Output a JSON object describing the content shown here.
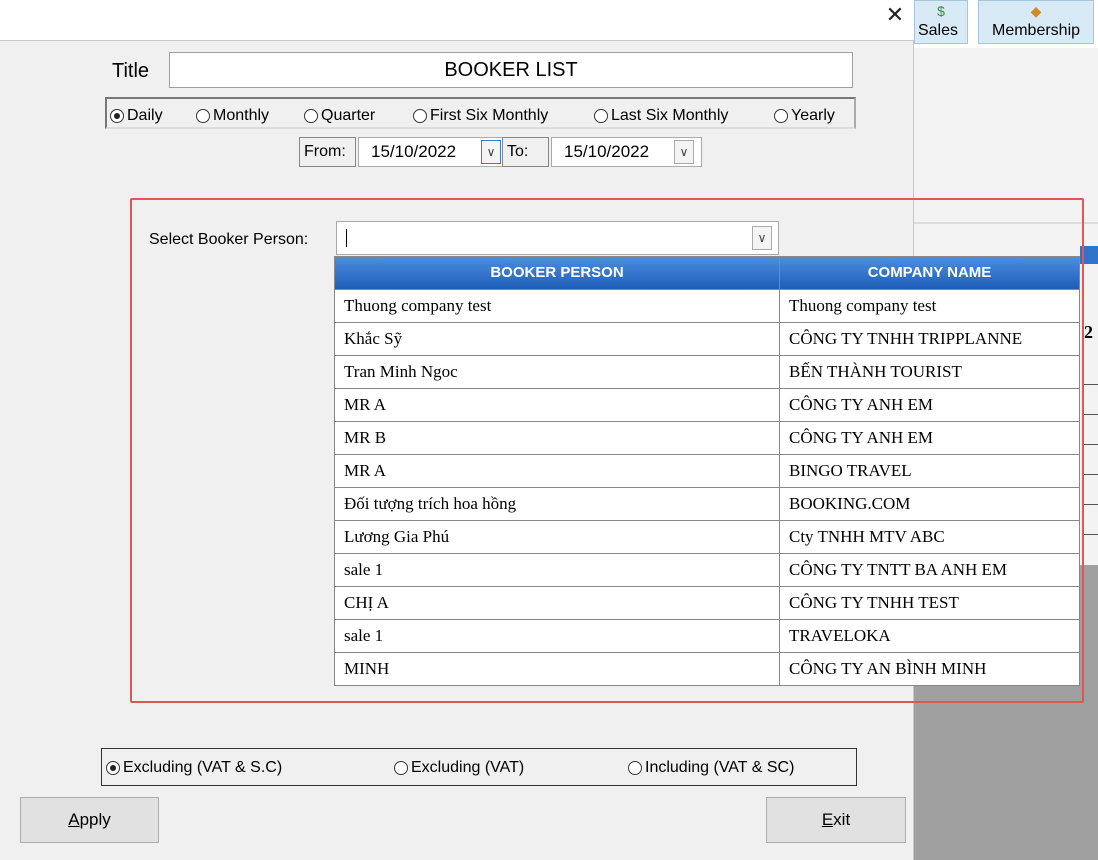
{
  "background_app": {
    "toolbar": [
      {
        "label": "Sales",
        "icon": "money-icon"
      },
      {
        "label": "Membership",
        "icon": "membership-icon"
      }
    ],
    "partial_value": "2"
  },
  "dialog": {
    "title_label": "Title",
    "title_value": "BOOKER LIST",
    "period_options": [
      {
        "label": "Daily",
        "selected": true
      },
      {
        "label": "Monthly",
        "selected": false
      },
      {
        "label": "Quarter",
        "selected": false
      },
      {
        "label": "First Six Monthly",
        "selected": false
      },
      {
        "label": "Last Six Monthly",
        "selected": false
      },
      {
        "label": "Yearly",
        "selected": false
      }
    ],
    "from_label": "From:",
    "from_value": "15/10/2022",
    "to_label": "To:",
    "to_value": "15/10/2022",
    "booker": {
      "label": "Select Booker Person:",
      "value": "",
      "columns": [
        "BOOKER PERSON",
        "COMPANY NAME"
      ],
      "rows": [
        [
          "Thuong company test",
          "Thuong company test"
        ],
        [
          "Khắc Sỹ",
          "CÔNG TY TNHH TRIPPLANNE"
        ],
        [
          "Tran Minh Ngoc",
          "BẾN THÀNH TOURIST"
        ],
        [
          "MR A",
          "CÔNG TY ANH EM"
        ],
        [
          "MR B",
          "CÔNG TY ANH EM"
        ],
        [
          "MR A",
          "BINGO TRAVEL"
        ],
        [
          "Đối tượng trích hoa hồng",
          "BOOKING.COM"
        ],
        [
          "Lương Gia Phú",
          "Cty TNHH MTV ABC"
        ],
        [
          "sale 1",
          "CÔNG TY TNTT BA ANH EM"
        ],
        [
          "CHỊ A",
          "CÔNG TY TNHH TEST"
        ],
        [
          "sale 1",
          "TRAVELOKA"
        ],
        [
          "MINH",
          "CÔNG TY AN BÌNH MINH"
        ]
      ]
    },
    "tax_options": [
      {
        "label": "Excluding (VAT & S.C)",
        "selected": true
      },
      {
        "label": "Excluding (VAT)",
        "selected": false
      },
      {
        "label": "Including (VAT & SC)",
        "selected": false
      }
    ],
    "apply_label": {
      "mnemonic": "A",
      "rest": "pply"
    },
    "exit_label": {
      "mnemonic": "E",
      "rest": "xit"
    },
    "highlight_color": "#e05555",
    "header_color": "#2f6fcf"
  }
}
